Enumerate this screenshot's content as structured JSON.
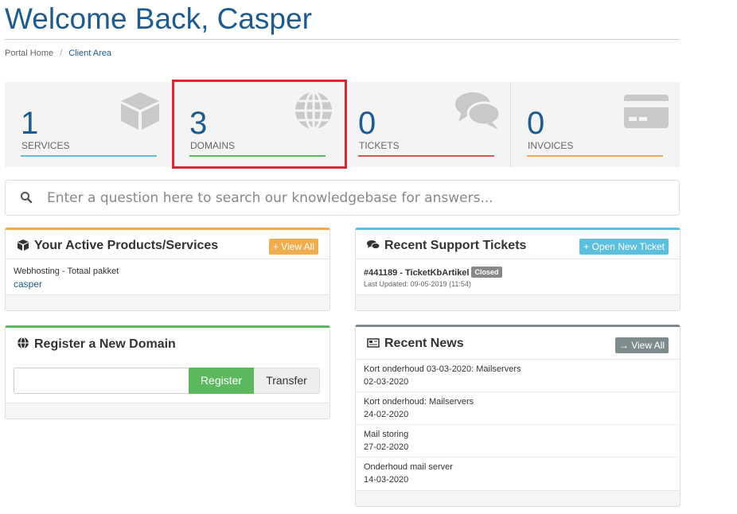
{
  "header": {
    "title": "Welcome Back, Casper"
  },
  "breadcrumb": {
    "items": [
      "Portal Home",
      "Client Area"
    ],
    "separator": "/"
  },
  "stats": [
    {
      "count": "1",
      "label": "SERVICES",
      "color": "#5bc0de",
      "icon": "cube-icon"
    },
    {
      "count": "3",
      "label": "DOMAINS",
      "color": "#5cb85c",
      "icon": "globe-icon"
    },
    {
      "count": "0",
      "label": "TICKETS",
      "color": "#d9534f",
      "icon": "comments-icon"
    },
    {
      "count": "0",
      "label": "INVOICES",
      "color": "#f0ad4e",
      "icon": "credit-card-icon"
    }
  ],
  "search": {
    "placeholder": "Enter a question here to search our knowledgebase for answers..."
  },
  "products_panel": {
    "title": "Your Active Products/Services",
    "button": "+ View All",
    "accent": "#f0ad4e",
    "items": [
      {
        "name": "Webhosting - Totaal pakket",
        "user": "casper"
      }
    ]
  },
  "tickets_panel": {
    "title": "Recent Support Tickets",
    "button": "+ Open New Ticket",
    "accent": "#5bc0de",
    "ticket": {
      "id_subject": "#441189 - TicketKbArtikel",
      "status": "Closed",
      "updated": "Last Updated: 09-05-2019 (11:54)"
    }
  },
  "domain_panel": {
    "title": "Register a New Domain",
    "accent": "#5cb85c",
    "register_label": "Register",
    "transfer_label": "Transfer"
  },
  "news_panel": {
    "title": "Recent News",
    "button": "→ View All",
    "accent": "#7f8c8d",
    "items": [
      {
        "title": "Kort onderhoud 03-03-2020: Mailservers",
        "date": "02-03-2020"
      },
      {
        "title": "Kort onderhoud: Mailservers",
        "date": "24-02-2020"
      },
      {
        "title": "Mail storing",
        "date": "27-02-2020"
      },
      {
        "title": "Onderhoud mail server",
        "date": "14-03-2020"
      }
    ]
  }
}
